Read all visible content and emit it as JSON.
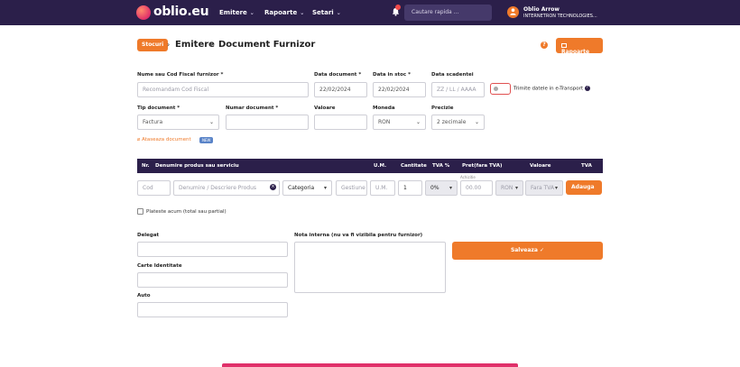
{
  "topbar": {
    "logo": "oblio.eu",
    "nav": [
      {
        "label": "Emitere"
      },
      {
        "label": "Rapoarte"
      },
      {
        "label": "Setari"
      }
    ],
    "search_placeholder": "Cautare rapida ...",
    "user_name": "Oblio Arrow",
    "user_company": "INTERNETRON TECHNOLOGIES..."
  },
  "breadcrumb": {
    "badge": "Stocuri",
    "level1": "Emitere",
    "level2": "Document Furnizor"
  },
  "actions": {
    "rapoarte": "Rapoarte"
  },
  "form": {
    "supplier_label": "Nume sau Cod Fiscal furnizor *",
    "supplier_placeholder": "Recomandam Cod Fiscal",
    "doc_date_label": "Data document *",
    "doc_date_value": "22/02/2024",
    "stock_date_label": "Data in stoc *",
    "stock_date_value": "22/02/2024",
    "due_date_label": "Data scadentei",
    "due_date_placeholder": "ZZ / LL / AAAA",
    "etransport_label": "Trimite datele in e-Transport",
    "doc_type_label": "Tip document *",
    "doc_type_value": "Factura",
    "doc_number_label": "Numar document *",
    "value_label": "Valoare",
    "currency_label": "Moneda",
    "currency_value": "RON",
    "precision_label": "Precizie",
    "precision_value": "2 zecimale",
    "attach_label": "Ataseaza document",
    "new_badge": "NEW"
  },
  "table": {
    "headers": [
      "Nr.",
      "Denumire produs sau serviciu",
      "U.M.",
      "Cantitate",
      "TVA %",
      "Pret(fara TVA)",
      "Valoare",
      "TVA"
    ],
    "row": {
      "code_placeholder": "Cod",
      "name_placeholder": "Denumire / Descriere Produs",
      "category_value": "Categoria",
      "management_placeholder": "Gestiune",
      "um_placeholder": "U.M.",
      "qty_value": "1",
      "vat_value": "0%",
      "price_label": "Achizitie",
      "price_placeholder": "00.00",
      "currency_value": "RON",
      "vat_mode_value": "Fara TVA",
      "add_button": "Adauga"
    },
    "paid_now_label": "Plateste acum (total sau partial)"
  },
  "footer_form": {
    "delegate_label": "Delegat",
    "id_card_label": "Carte Identitate",
    "auto_label": "Auto",
    "internal_note_label": "Nota interna (nu va fi vizibila pentru furnizor)",
    "save_button": "Salveaza"
  },
  "colors": {
    "topbar": "#2b1f4a",
    "accent": "#ef7a2a",
    "bottom_bar": "#e0306a"
  }
}
